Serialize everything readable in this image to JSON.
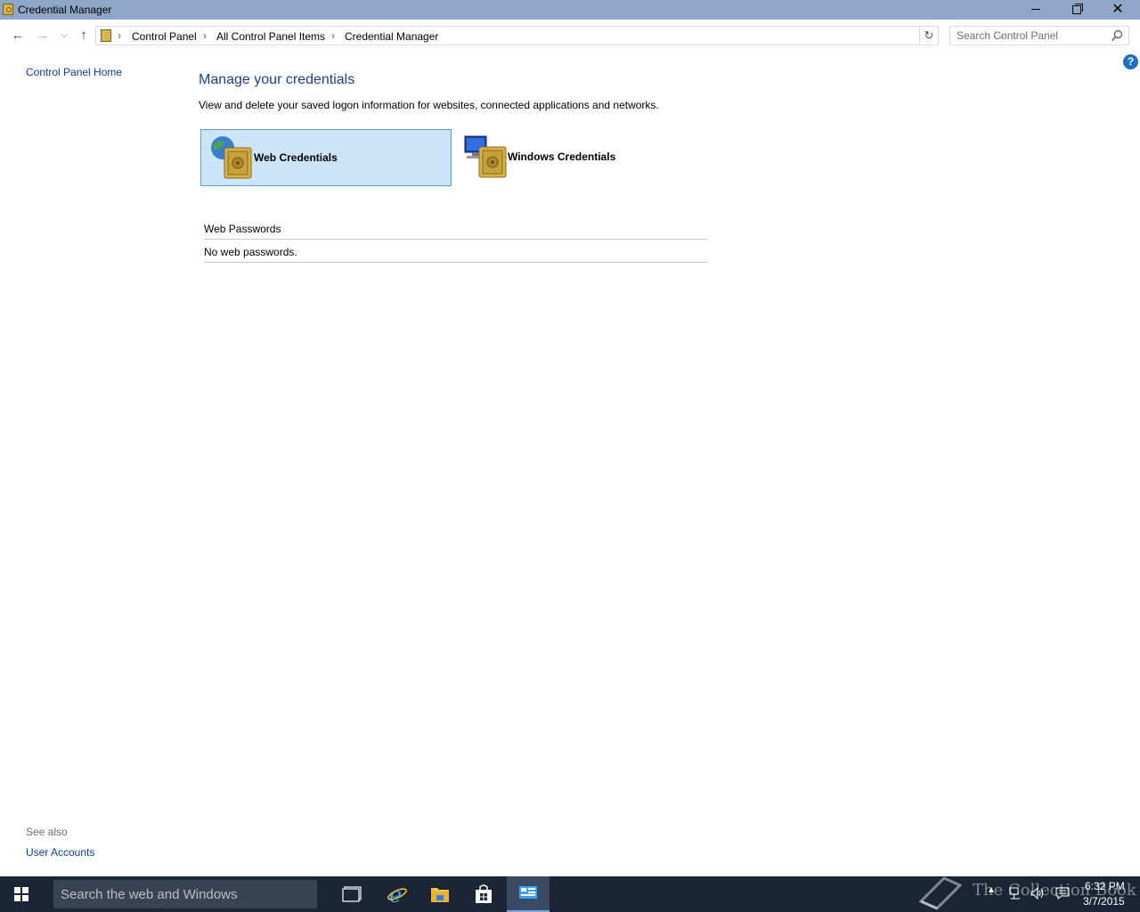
{
  "window": {
    "title": "Credential Manager"
  },
  "address": {
    "crumbs": [
      "Control Panel",
      "All Control Panel Items",
      "Credential Manager"
    ],
    "search_placeholder": "Search Control Panel"
  },
  "left_pane": {
    "home_link": "Control Panel Home",
    "see_also_label": "See also",
    "see_also_links": [
      "User Accounts"
    ]
  },
  "main": {
    "title": "Manage your credentials",
    "description": "View and delete your saved logon information for websites, connected applications and networks.",
    "tiles": [
      {
        "label": "Web Credentials",
        "selected": true,
        "icon": "globe-safe-icon"
      },
      {
        "label": "Windows Credentials",
        "selected": false,
        "icon": "computer-safe-icon"
      }
    ],
    "section_header": "Web Passwords",
    "empty_message": "No web passwords."
  },
  "taskbar": {
    "search_placeholder": "Search the web and Windows",
    "time": "6:32 PM",
    "date": "3/7/2015",
    "watermark": "The Collection Book"
  },
  "colors": {
    "titlebar": "#8ea6c7",
    "selected_tile": "#cce4f7",
    "link": "#0a3d91",
    "heading": "#1e3d8f",
    "taskbar": "#1c2535"
  }
}
